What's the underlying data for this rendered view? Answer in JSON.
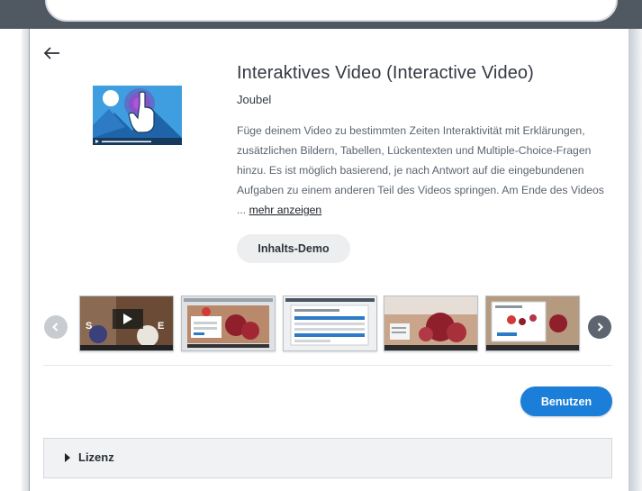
{
  "header": {
    "search": {
      "value": ""
    }
  },
  "content": {
    "back_icon": "arrow-left-icon",
    "title": "Interaktives Video (Interactive Video)",
    "author": "Joubel",
    "description": "Füge deinem Video zu bestimmten Zeiten Interaktivität mit Erklärungen, zusätzlichen Bildern, Tabellen, Lückentexten und Multiple-Choice-Fragen hinzu. Es ist möglich basierend, je nach Antwort auf die eingebundenen Aufgaben zu einem anderen Teil des Videos springen. Am Ende des Videos ...",
    "more_link": "mehr anzeigen",
    "demo_button": "Inhalts-Demo"
  },
  "carousel": {
    "prev_icon": "chevron-left-icon",
    "next_icon": "chevron-right-icon",
    "thumbnails": [
      "screenshot-1",
      "screenshot-2",
      "screenshot-3",
      "screenshot-4",
      "screenshot-5"
    ]
  },
  "actions": {
    "use_button": "Benutzen"
  },
  "license": {
    "label": "Lizenz",
    "expand_icon": "caret-right-icon"
  },
  "colors": {
    "accent": "#1b7ed8",
    "topbar": "#505862",
    "text": "#333a42"
  }
}
